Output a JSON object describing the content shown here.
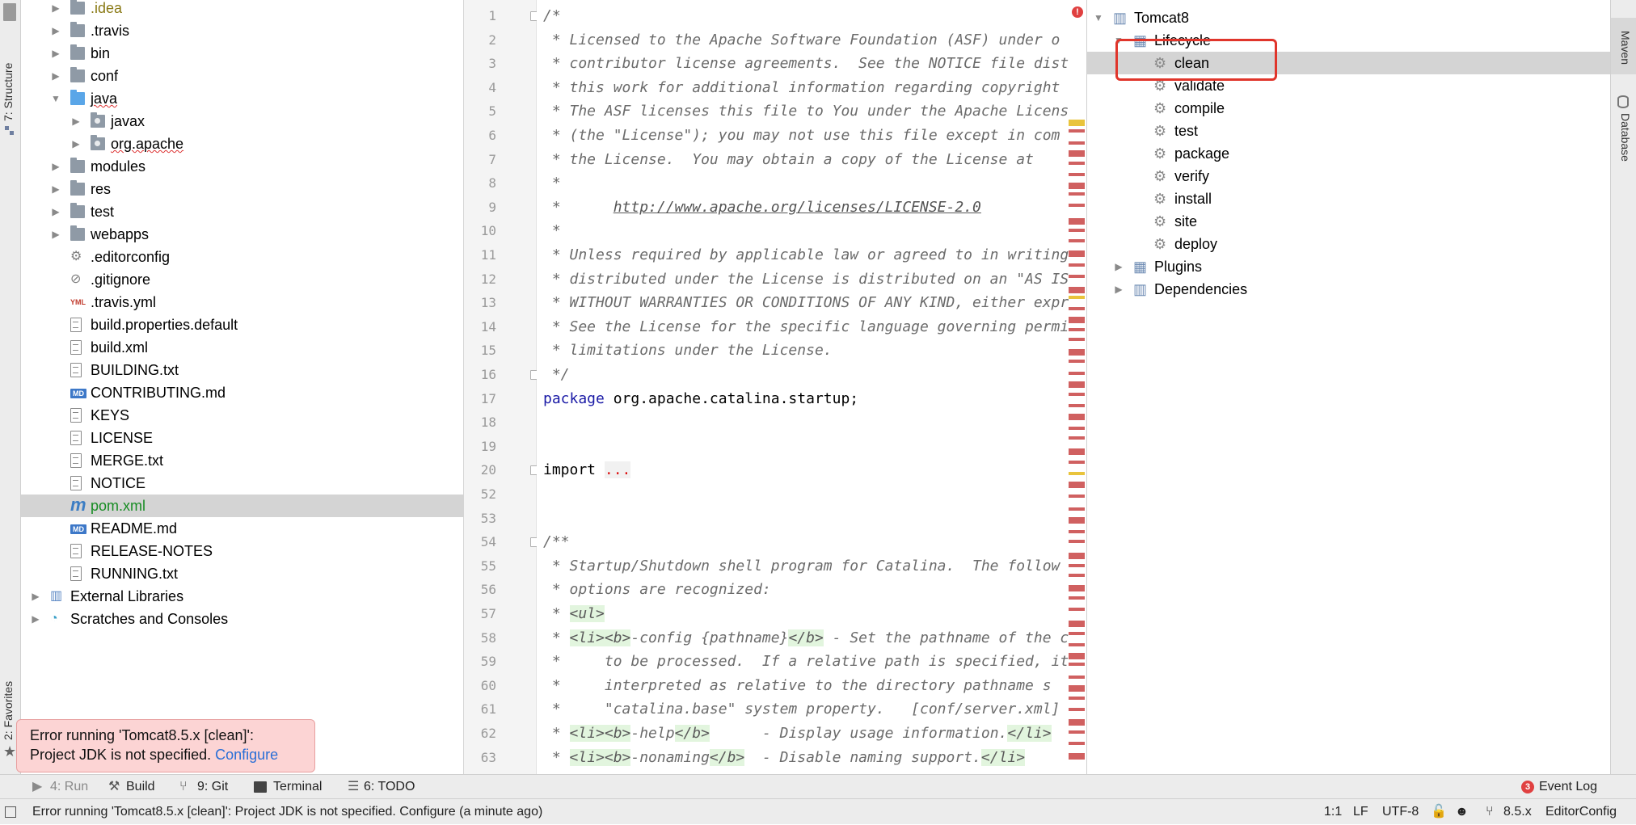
{
  "left_strip": {
    "structure_tab": "7: Structure",
    "favorites_tab": "2: Favorites",
    "project_tab": "1"
  },
  "right_strip": {
    "maven_tab": "Maven",
    "database_tab": "Database"
  },
  "project_tree": [
    {
      "label": ".idea",
      "kind": "folder",
      "color": "olive"
    },
    {
      "label": ".travis",
      "kind": "folder"
    },
    {
      "label": "bin",
      "kind": "folder"
    },
    {
      "label": "conf",
      "kind": "folder"
    },
    {
      "label": "java",
      "kind": "folder",
      "expanded": true
    },
    {
      "label": "javax",
      "kind": "package"
    },
    {
      "label": "org.apache",
      "kind": "package"
    },
    {
      "label": "modules",
      "kind": "folder"
    },
    {
      "label": "res",
      "kind": "folder"
    },
    {
      "label": "test",
      "kind": "folder"
    },
    {
      "label": "webapps",
      "kind": "folder"
    },
    {
      "label": ".editorconfig",
      "kind": "gear"
    },
    {
      "label": ".gitignore",
      "kind": "gitignore"
    },
    {
      "label": ".travis.yml",
      "kind": "yml"
    },
    {
      "label": "build.properties.default",
      "kind": "file"
    },
    {
      "label": "build.xml",
      "kind": "file"
    },
    {
      "label": "BUILDING.txt",
      "kind": "file"
    },
    {
      "label": "CONTRIBUTING.md",
      "kind": "md"
    },
    {
      "label": "KEYS",
      "kind": "file"
    },
    {
      "label": "LICENSE",
      "kind": "file"
    },
    {
      "label": "MERGE.txt",
      "kind": "file"
    },
    {
      "label": "NOTICE",
      "kind": "file"
    },
    {
      "label": "pom.xml",
      "kind": "maven",
      "selected": true
    },
    {
      "label": "README.md",
      "kind": "md"
    },
    {
      "label": "RELEASE-NOTES",
      "kind": "file"
    },
    {
      "label": "RUNNING.txt",
      "kind": "file"
    },
    {
      "label": "External Libraries",
      "kind": "libraries"
    },
    {
      "label": "Scratches and Consoles",
      "kind": "scratches"
    }
  ],
  "editor": {
    "lines": [
      {
        "n": "1",
        "text": "/*"
      },
      {
        "n": "2",
        "text": " * Licensed to the Apache Software Foundation (ASF) under o"
      },
      {
        "n": "3",
        "text": " * contributor license agreements.  See the NOTICE file dist"
      },
      {
        "n": "4",
        "text": " * this work for additional information regarding copyright"
      },
      {
        "n": "5",
        "text": " * The ASF licenses this file to You under the Apache Licens"
      },
      {
        "n": "6",
        "text": " * (the \"License\"); you may not use this file except in com"
      },
      {
        "n": "7",
        "text": " * the License.  You may obtain a copy of the License at"
      },
      {
        "n": "8",
        "text": " *"
      },
      {
        "n": "9",
        "text": " *      ",
        "link": "http://www.apache.org/licenses/LICENSE-2.0"
      },
      {
        "n": "10",
        "text": " *"
      },
      {
        "n": "11",
        "text": " * Unless required by applicable law or agreed to in writing"
      },
      {
        "n": "12",
        "text": " * distributed under the License is distributed on an \"AS IS"
      },
      {
        "n": "13",
        "text": " * WITHOUT WARRANTIES OR CONDITIONS OF ANY KIND, either expr"
      },
      {
        "n": "14",
        "text": " * See the License for the specific language governing permi"
      },
      {
        "n": "15",
        "text": " * limitations under the License."
      },
      {
        "n": "16",
        "text": " */"
      },
      {
        "n": "17",
        "kw": "package",
        "text": " org.apache.catalina.startup;"
      },
      {
        "n": "18",
        "text": ""
      },
      {
        "n": "19",
        "text": ""
      },
      {
        "n": "20",
        "kw2": "import ",
        "folded": "..."
      },
      {
        "n": "52",
        "text": ""
      },
      {
        "n": "53",
        "text": ""
      },
      {
        "n": "54",
        "text": "/**"
      },
      {
        "n": "55",
        "text": " * Startup/Shutdown shell program for Catalina.  The follow"
      },
      {
        "n": "56",
        "text": " * options are recognized:"
      },
      {
        "n": "57",
        "text": " * ",
        "tag": "<ul>"
      },
      {
        "n": "58",
        "text": " * ",
        "tag": "<li><b>",
        "rest": "-config {pathname}",
        "tag2": "</b>",
        "rest2": " - Set the pathname of the c"
      },
      {
        "n": "59",
        "text": " *     to be processed.  If a relative path is specified, it"
      },
      {
        "n": "60",
        "text": " *     interpreted as relative to the directory pathname s"
      },
      {
        "n": "61",
        "text": " *     \"catalina.base\" system property.   [conf/server.xml]"
      },
      {
        "n": "62",
        "text": " * ",
        "tag": "<li><b>",
        "rest": "-help",
        "tag2": "</b>",
        "rest2": "      - Display usage information.",
        "tag3": "</li>"
      },
      {
        "n": "63",
        "text": " * ",
        "tag": "<li><b>",
        "rest": "-nonaming",
        "tag2": "</b>",
        "rest2": "  - Disable naming support.",
        "tag3": "</li>"
      }
    ]
  },
  "maven": {
    "root": "Tomcat8",
    "lifecycle": "Lifecycle",
    "goals": [
      "clean",
      "validate",
      "compile",
      "test",
      "package",
      "verify",
      "install",
      "site",
      "deploy"
    ],
    "plugins": "Plugins",
    "dependencies": "Dependencies"
  },
  "toolbar": {
    "run": "4: Run",
    "build": "Build",
    "git": "9: Git",
    "terminal": "Terminal",
    "todo": "6: TODO",
    "event_log": "Event Log",
    "event_count": "3"
  },
  "balloon": {
    "line1": "Error running 'Tomcat8.5.x [clean]':",
    "line2": "Project JDK is not specified. ",
    "configure": "Configure"
  },
  "status": {
    "message": "Error running 'Tomcat8.5.x [clean]': Project JDK is not specified. Configure (a minute ago)",
    "position": "1:1",
    "line_sep": "LF",
    "encoding": "UTF-8",
    "branch": "8.5.x",
    "editorconfig": "EditorConfig"
  },
  "colors": {
    "highlight_box": "#e0352b",
    "selection": "#d4d4d4",
    "error_balloon": "#fcd4d4",
    "link": "#2a6fd6"
  }
}
